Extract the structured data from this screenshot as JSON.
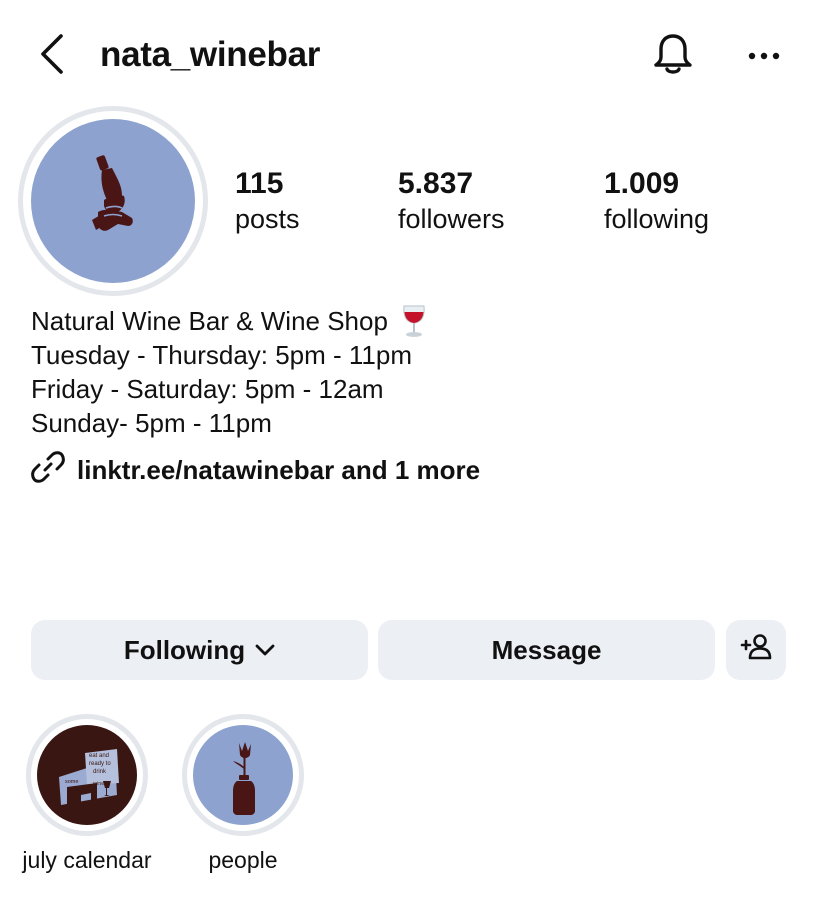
{
  "header": {
    "username": "nata_winebar",
    "icons": {
      "back": "chevron-left-icon",
      "notifications": "bell-icon",
      "more": "more-horizontal-icon"
    }
  },
  "profile": {
    "avatar_bg": "#8da2cf",
    "avatar_icon": "wine-bottle-logo",
    "brand_color": "#4a1515"
  },
  "stats": {
    "posts": {
      "value": "115",
      "label": "posts"
    },
    "followers": {
      "value": "5.837",
      "label": "followers"
    },
    "following": {
      "value": "1.009",
      "label": "following"
    }
  },
  "bio": {
    "lines": [
      "Natural Wine Bar & Wine Shop",
      "Tuesday - Thursday: 5pm - 11pm",
      "Friday - Saturday: 5pm - 12am",
      "Sunday- 5pm - 11pm"
    ],
    "emoji": "wine-glass-icon",
    "link": "linktr.ee/natawinebar and 1 more"
  },
  "actions": {
    "following_label": "Following",
    "message_label": "Message",
    "add_person_icon": "add-person-icon"
  },
  "highlights": [
    {
      "label": "july calendar",
      "bg": "#3a1612",
      "poster_text": [
        "eat and",
        "ready to",
        "drink",
        "some",
        "wine"
      ]
    },
    {
      "label": "people",
      "bg": "#8da2cf"
    }
  ],
  "colors": {
    "button_bg": "#eceff3",
    "ring": "#e3e6ea",
    "text": "#111111"
  }
}
